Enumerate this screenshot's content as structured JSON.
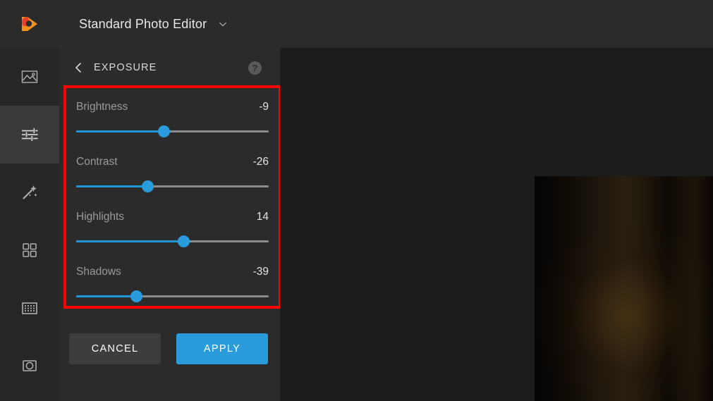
{
  "topbar": {
    "logo_icon": "pixlr-c-logo-icon",
    "app_title": "Standard Photo Editor",
    "chevron_icon": "chevron-down-icon"
  },
  "sidebar": {
    "items": [
      {
        "name": "photo",
        "icon": "image-icon",
        "active": false
      },
      {
        "name": "adjust",
        "icon": "sliders-icon",
        "active": true
      },
      {
        "name": "effects",
        "icon": "magic-wand-icon",
        "active": false
      },
      {
        "name": "overlays",
        "icon": "grid-squares-icon",
        "active": false
      },
      {
        "name": "borders",
        "icon": "texture-frame-icon",
        "active": false
      },
      {
        "name": "vignette",
        "icon": "lens-circle-icon",
        "active": false
      }
    ]
  },
  "panel": {
    "back_icon": "chevron-left-icon",
    "title": "EXPOSURE",
    "help_icon": "help-question-icon",
    "help_label": "?",
    "sliders": [
      {
        "label": "Brightness",
        "value": "-9",
        "percent": 45.5
      },
      {
        "label": "Contrast",
        "value": "-26",
        "percent": 37.0
      },
      {
        "label": "Highlights",
        "value": "14",
        "percent": 56.0
      },
      {
        "label": "Shadows",
        "value": "-39",
        "percent": 31.5
      }
    ],
    "cancel_label": "CANCEL",
    "apply_label": "APPLY"
  },
  "colors": {
    "accent": "#2b9cdb",
    "highlight_box": "#ff0000",
    "topbar_bg": "#2b2b2b",
    "panel_bg": "#2b2b2b",
    "rail_bg": "#262626",
    "rail_active_bg": "#3a3a3a",
    "canvas_bg": "#1c1c1c",
    "logo_orange": "#f5921e",
    "logo_red": "#e8402a"
  }
}
